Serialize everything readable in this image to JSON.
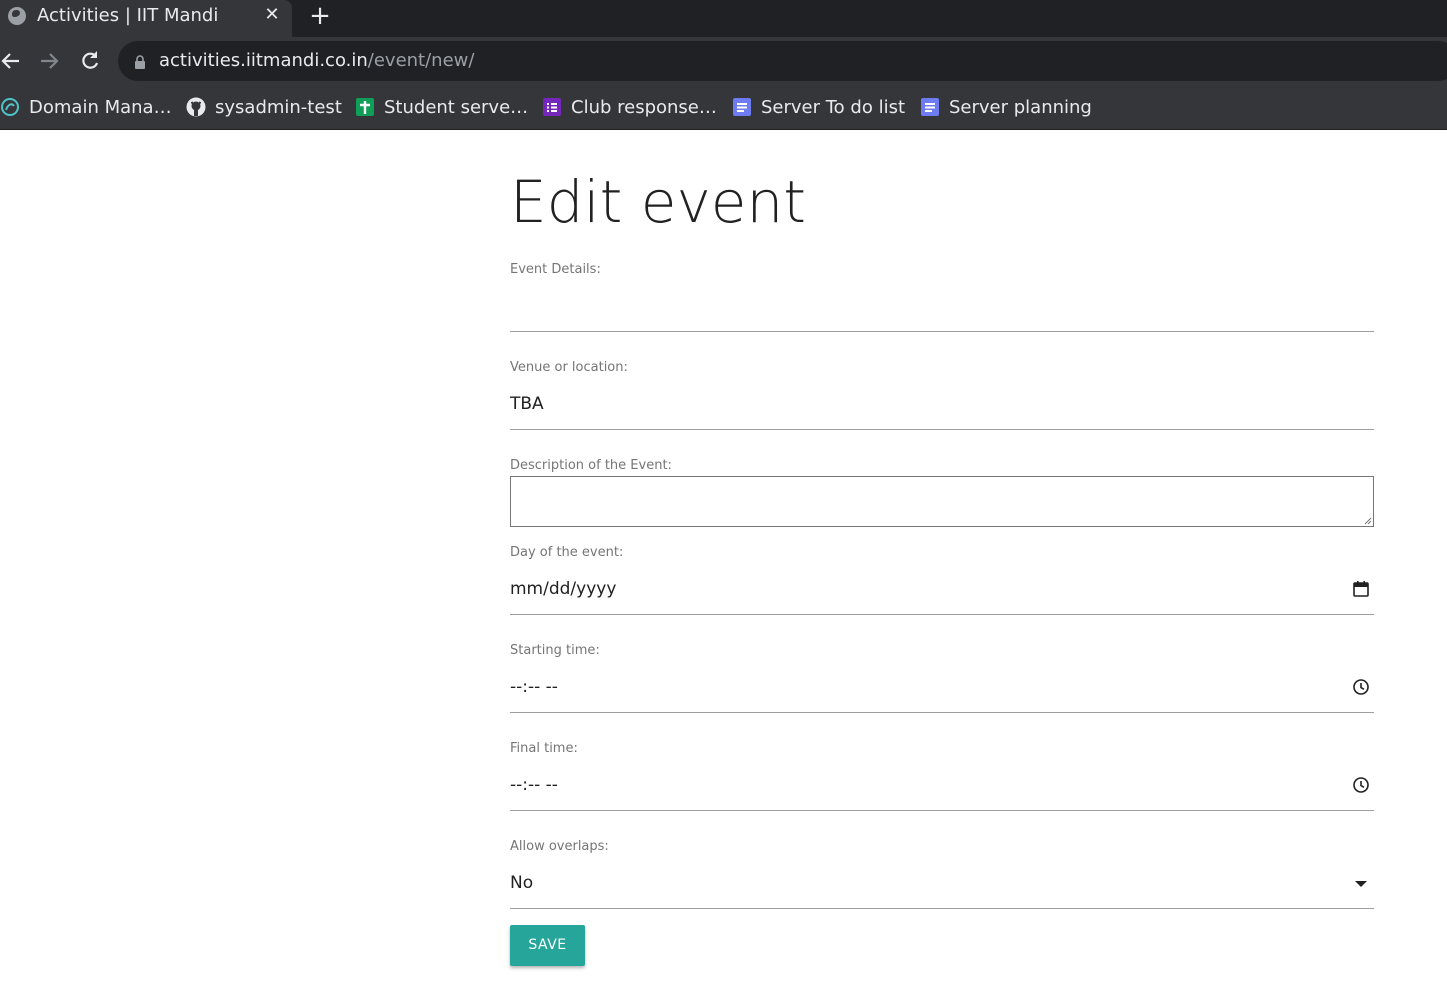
{
  "browser": {
    "tab": {
      "title": "Activities | IIT Mandi",
      "favicon": "globe-icon"
    },
    "address": {
      "host": "activities.iitmandi.co.in",
      "path": "/event/new/"
    },
    "bookmarks": [
      {
        "label": "Domain Mana…",
        "icon": "domain-icon"
      },
      {
        "label": "sysadmin-test",
        "icon": "github-icon"
      },
      {
        "label": "Student serve…",
        "icon": "sheets-icon"
      },
      {
        "label": "Club response…",
        "icon": "forms-icon"
      },
      {
        "label": "Server To do list",
        "icon": "docs-icon"
      },
      {
        "label": "Server planning",
        "icon": "docs-icon"
      }
    ]
  },
  "form": {
    "title": "Edit event",
    "event_details": {
      "label": "Event Details:",
      "value": ""
    },
    "venue": {
      "label": "Venue or location:",
      "value": "TBA"
    },
    "description": {
      "label": "Description of the Event:",
      "value": ""
    },
    "day": {
      "label": "Day of the event:",
      "placeholder": "mm/dd/yyyy"
    },
    "start_time": {
      "label": "Starting time:",
      "placeholder": "--:-- --"
    },
    "final_time": {
      "label": "Final time:",
      "placeholder": "--:-- --"
    },
    "overlaps": {
      "label": "Allow overlaps:",
      "selected": "No"
    },
    "save_label": "SAVE"
  },
  "colors": {
    "accent": "#26a69a",
    "chrome_dark": "#202124",
    "chrome_mid": "#35363a"
  }
}
